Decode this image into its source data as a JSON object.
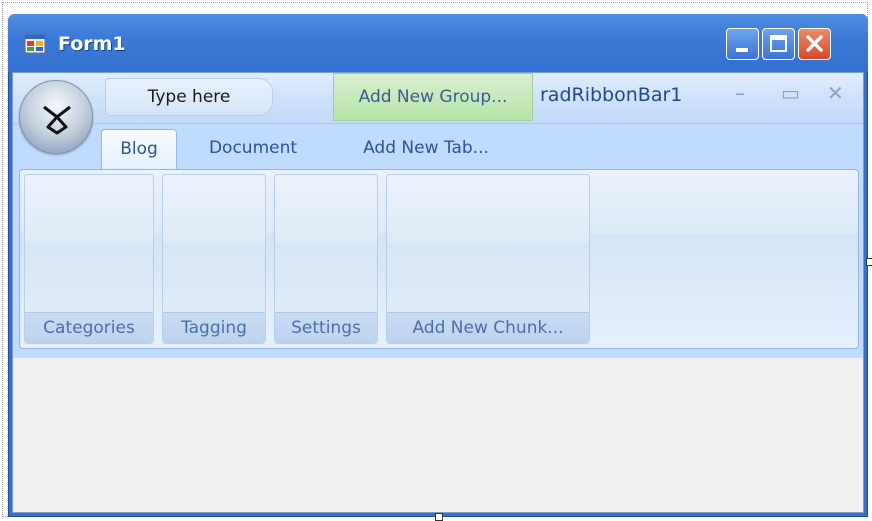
{
  "window": {
    "title": "Form1",
    "colors": {
      "titlebar": "#3c7ad8",
      "close": "#d4492b"
    }
  },
  "ribbon": {
    "quick_access_placeholder": "Type here",
    "add_group_label": "Add New Group...",
    "caption": "radRibbonBar1",
    "controls": {
      "minimize": "–",
      "restore": "▭",
      "close": "✕"
    },
    "tabs": [
      {
        "label": "Blog",
        "active": true
      },
      {
        "label": "Document",
        "active": false
      },
      {
        "label": "Add New Tab...",
        "active": false
      }
    ],
    "chunks": [
      {
        "label": "Categories"
      },
      {
        "label": "Tagging"
      },
      {
        "label": "Settings"
      },
      {
        "label": "Add New Chunk..."
      }
    ]
  }
}
